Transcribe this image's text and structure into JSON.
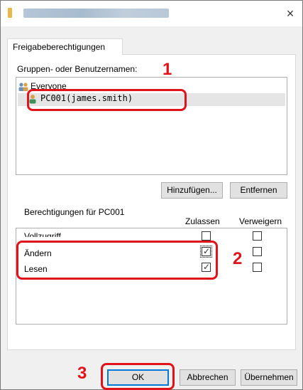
{
  "window": {
    "close_glyph": "×"
  },
  "tab": {
    "label": "Freigabeberechtigungen"
  },
  "groups": {
    "label": "Gruppen- oder Benutzernamen:",
    "users": [
      {
        "name": "Everyone",
        "icon": "group-icon"
      },
      {
        "name": "PC001(james.smith)",
        "icon": "user-icon"
      }
    ],
    "selected_index": 1
  },
  "buttons": {
    "add": "Hinzufügen...",
    "remove": "Entfernen",
    "ok": "OK",
    "cancel": "Abbrechen",
    "apply": "Übernehmen"
  },
  "permissions": {
    "label": "Berechtigungen für PC001",
    "col_allow": "Zulassen",
    "col_deny": "Verweigern",
    "rows": [
      {
        "name": "Vollzugriff",
        "allow": false,
        "deny": false
      },
      {
        "name": "Ändern",
        "allow": true,
        "deny": false
      },
      {
        "name": "Lesen",
        "allow": true,
        "deny": false
      }
    ]
  },
  "callouts": {
    "step1": "1",
    "step2": "2",
    "step3": "3"
  },
  "colors": {
    "callout": "#e0131b",
    "focus": "#0078d7"
  }
}
